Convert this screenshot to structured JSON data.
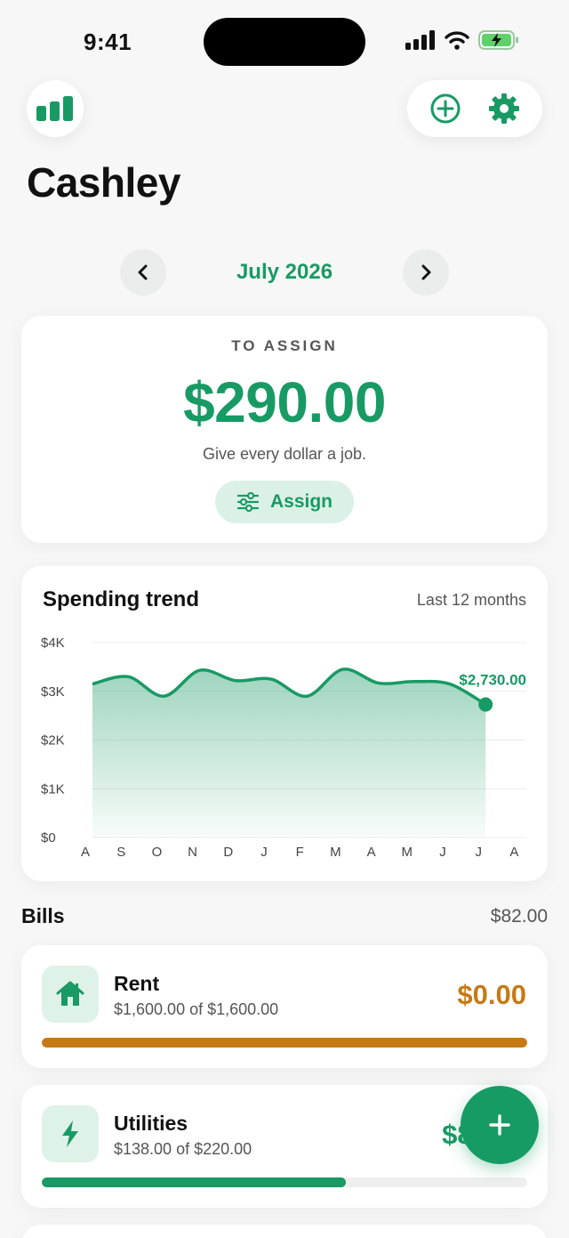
{
  "status": {
    "time": "9:41"
  },
  "app": {
    "title": "Cashley"
  },
  "icons": {
    "stats": "bar-chart-icon",
    "add": "plus-circle-icon",
    "settings": "gear-icon",
    "prev": "chevron-left-icon",
    "next": "chevron-right-icon",
    "assign": "sliders-icon",
    "rent": "home-icon",
    "utilities": "bolt-icon",
    "fab": "plus-icon"
  },
  "colors": {
    "accent": "#189a64",
    "warning": "#c67a14",
    "accent_light": "#dcf1e6"
  },
  "month_nav": {
    "label": "July 2026"
  },
  "assign_card": {
    "label": "TO ASSIGN",
    "amount": "$290.00",
    "subtitle": "Give every dollar a job.",
    "button_label": "Assign"
  },
  "trend": {
    "title": "Spending trend",
    "range": "Last 12 months",
    "callout": "$2,730.00"
  },
  "chart_data": {
    "type": "area",
    "title": "Spending trend",
    "x": [
      "A",
      "S",
      "O",
      "N",
      "D",
      "J",
      "F",
      "M",
      "A",
      "M",
      "J",
      "J",
      "A"
    ],
    "y_ticks": [
      "$0",
      "$1K",
      "$2K",
      "$3K",
      "$4K"
    ],
    "ylim": [
      0,
      4000
    ],
    "series": [
      {
        "values": [
          3150,
          3300,
          2900,
          3430,
          3220,
          3250,
          2900,
          3450,
          3170,
          3200,
          3150,
          2730
        ]
      }
    ],
    "highlight": {
      "index": 11,
      "label": "$2,730.00"
    },
    "grid": true
  },
  "bills": {
    "header": "Bills",
    "total": "$82.00",
    "items": [
      {
        "name": "Rent",
        "detail": "$1,600.00 of $1,600.00",
        "amount": "$0.00",
        "progress": 1.0,
        "color": "#c67a14"
      },
      {
        "name": "Utilities",
        "detail": "$138.00 of $220.00",
        "amount": "$82.00",
        "progress": 0.627,
        "color": "#189a64"
      }
    ]
  }
}
